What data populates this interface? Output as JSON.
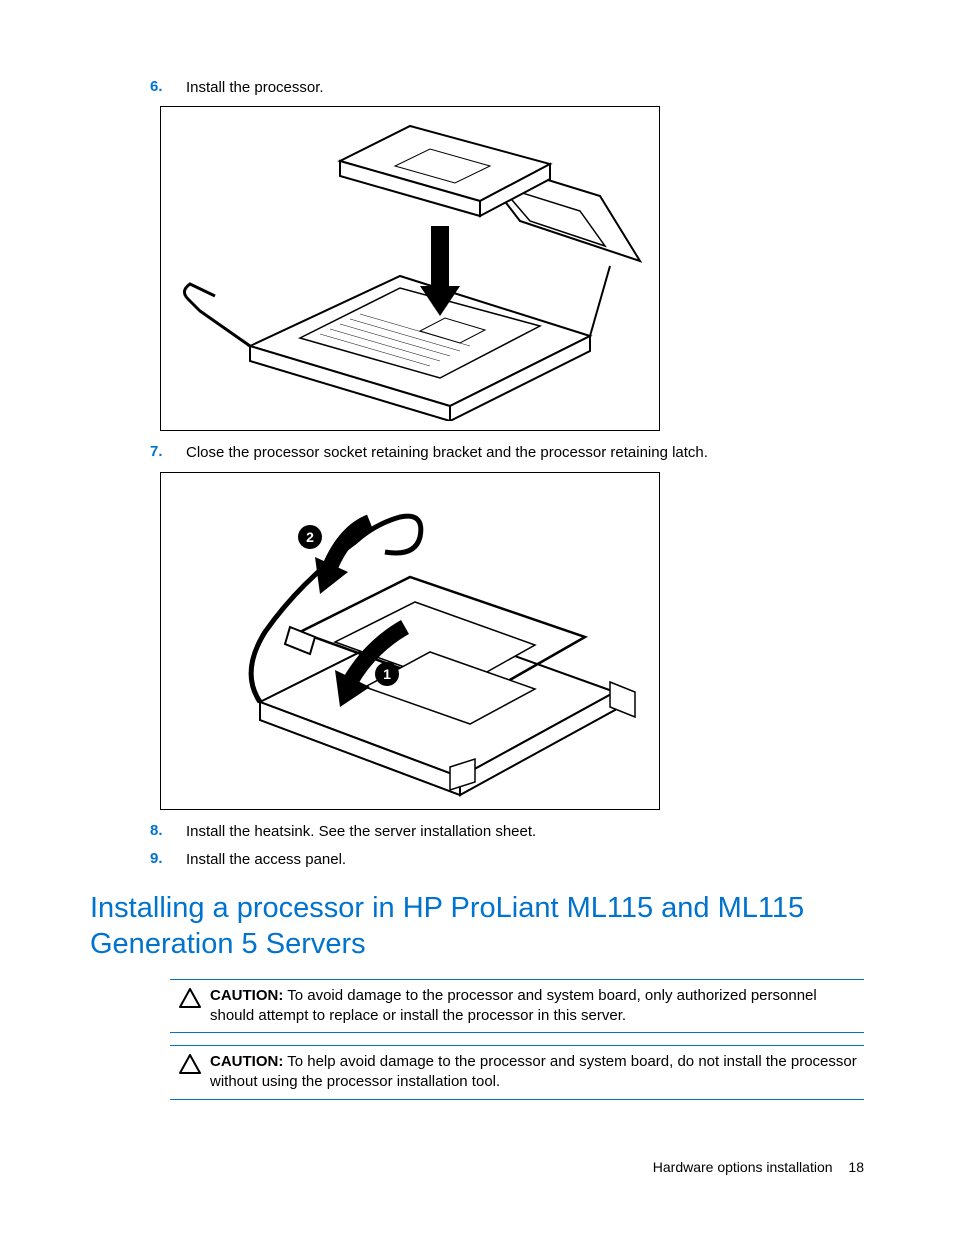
{
  "steps": [
    {
      "num": "6.",
      "text": "Install the processor."
    },
    {
      "num": "7.",
      "text": "Close the processor socket retaining bracket and the processor retaining latch."
    },
    {
      "num": "8.",
      "text": "Install the heatsink. See the server installation sheet."
    },
    {
      "num": "9.",
      "text": "Install the access panel."
    }
  ],
  "heading": "Installing a processor in HP ProLiant ML115 and ML115 Generation 5 Servers",
  "cautions": [
    {
      "label": "CAUTION:",
      "text": "To avoid damage to the processor and system board, only authorized personnel should attempt to replace or install the processor in this server."
    },
    {
      "label": "CAUTION:",
      "text": "To help avoid damage to the processor and system board, do not install the processor without using the processor installation tool."
    }
  ],
  "footer": {
    "section": "Hardware options installation",
    "page": "18"
  },
  "figures": {
    "fig1_alt": "Processor being lowered into open CPU socket with retaining bracket lifted",
    "fig2_alt": "Closing the processor socket retaining bracket (step 1) and latch (step 2)",
    "fig2_callouts": [
      "1",
      "2"
    ]
  }
}
